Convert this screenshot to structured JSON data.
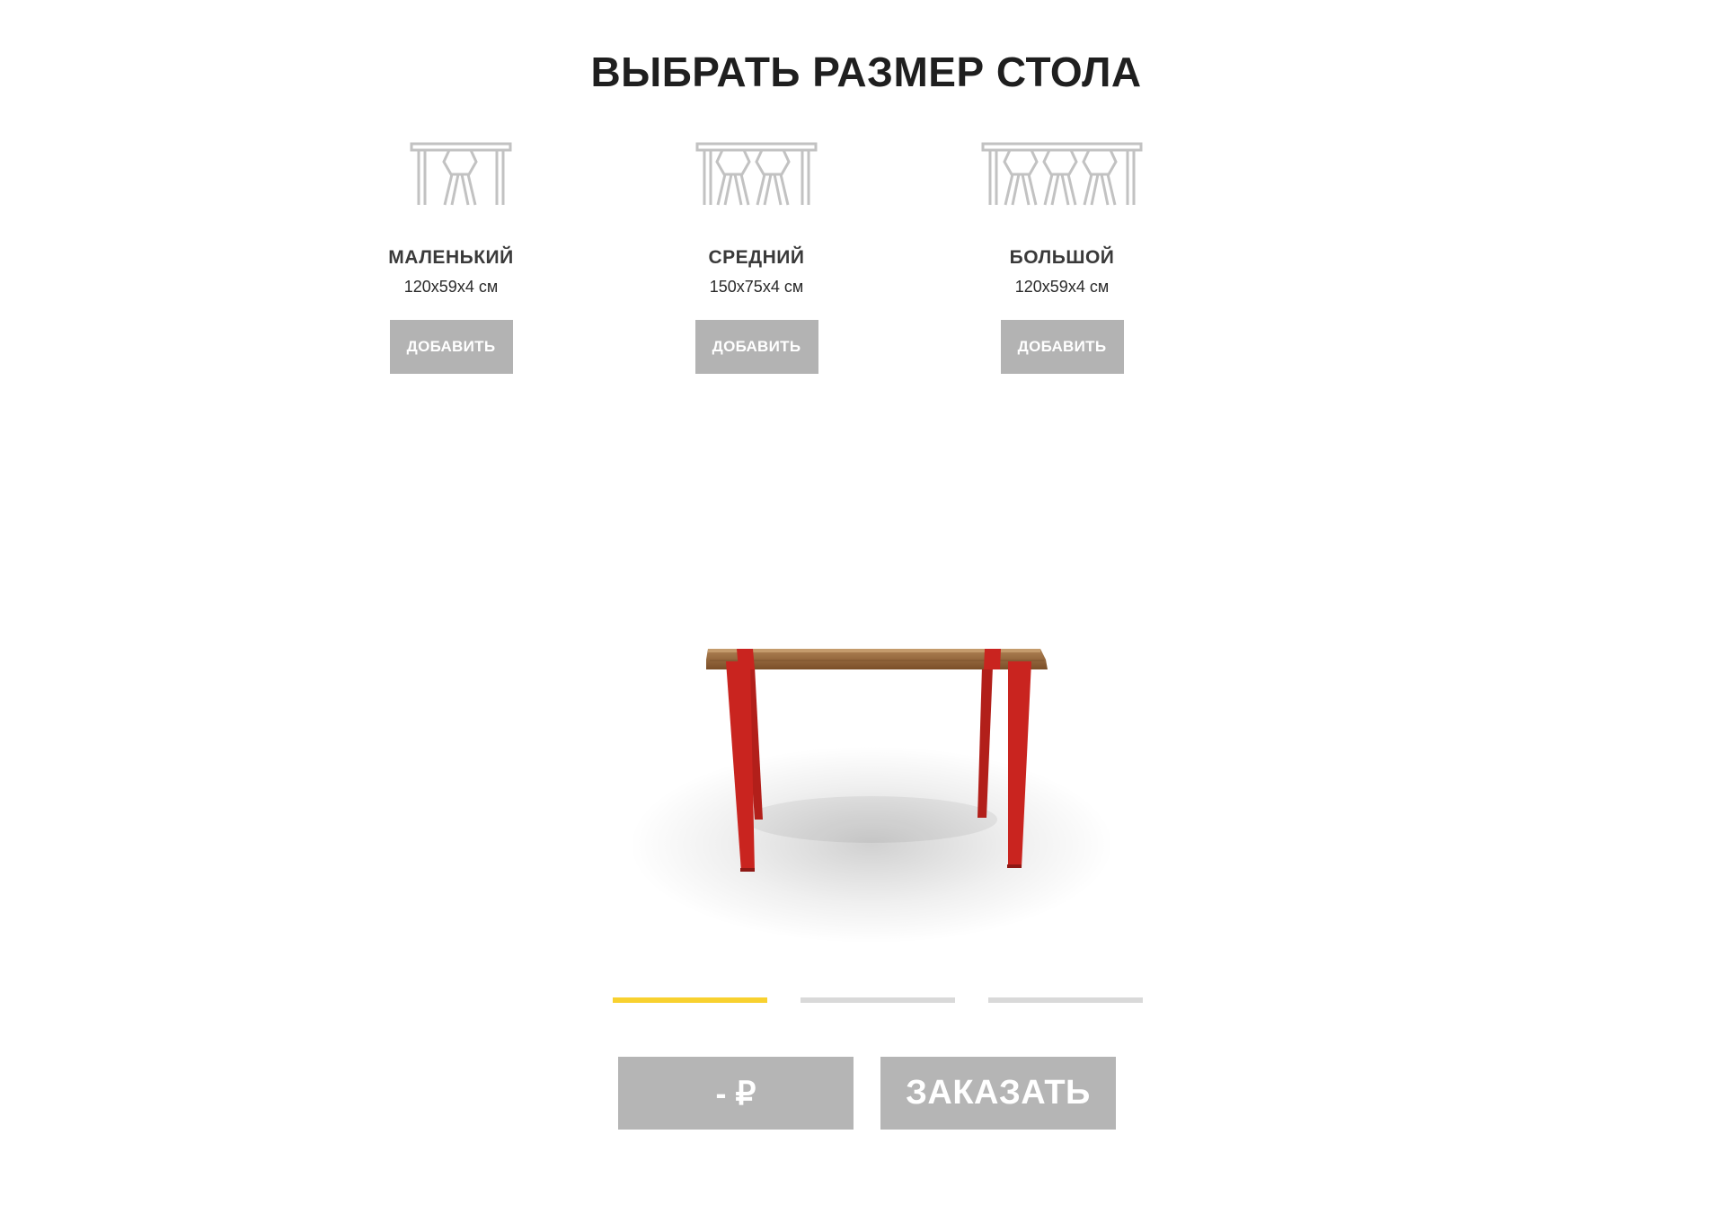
{
  "header": {
    "title": "ВЫБРАТЬ РАЗМЕР СТОЛА"
  },
  "sizes": [
    {
      "name": "МАЛЕНЬКИЙ",
      "dimensions": "120x59x4 см",
      "add_label": "ДОБАВИТЬ",
      "icon": "table-one-chair-icon"
    },
    {
      "name": "СРЕДНИЙ",
      "dimensions": "150x75x4 см",
      "add_label": "ДОБАВИТЬ",
      "icon": "table-two-chairs-icon"
    },
    {
      "name": "БОЛЬШОЙ",
      "dimensions": "120x59x4 см",
      "add_label": "ДОБАВИТЬ",
      "icon": "table-three-chairs-icon"
    }
  ],
  "slider": {
    "count": 3,
    "active_index": 0,
    "active_color": "#f8d12f",
    "inactive_color": "#d9d9d9"
  },
  "actions": {
    "price": "- ₽",
    "order_label": "ЗАКАЗАТЬ"
  },
  "colors": {
    "button_gray": "#b5b5b5",
    "leg_red": "#c9241f",
    "wood": "#8a5a2f"
  }
}
